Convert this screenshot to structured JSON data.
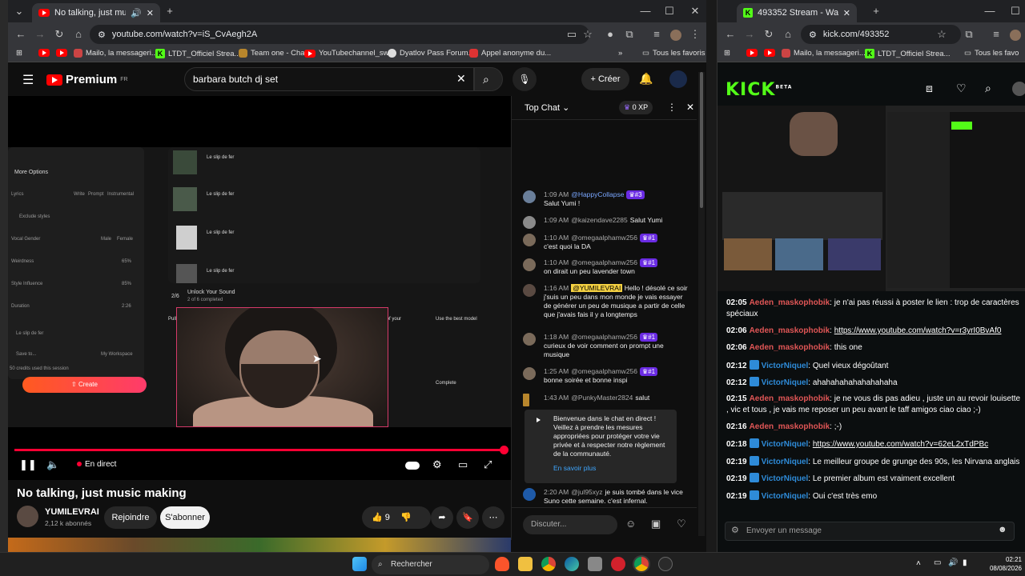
{
  "left_window": {
    "tab_title": "No talking, just music making",
    "url": "youtube.com/watch?v=iS_CvAegh2A",
    "bookmarks": [
      "Mailo, la messageri...",
      "LTDT_Officiel Strea...",
      "Team one - Chat",
      "YouTubechannel_sw...",
      "Dyatlov Pass Forum...",
      "Appel anonyme du..."
    ],
    "bookmarks_all": "Tous les favoris",
    "youtube": {
      "logo": "Premium",
      "logo_sup": "FR",
      "search_value": "barbara butch dj set",
      "create_label": "Créer",
      "video": {
        "live_label": "En direct",
        "progress": 1.0,
        "screen_text": {
          "more_options": "More Options",
          "lyrics": "Lyrics",
          "write": "Write",
          "prompt": "Prompt",
          "instrumental": "Instrumental",
          "exclude_styles": "Exclude styles",
          "vocal_gender": "Vocal Gender",
          "male": "Male",
          "female": "Female",
          "weirdness": "Weirdness",
          "weirdness_val": "65%",
          "style_influence": "Style Influence",
          "style_val": "85%",
          "duration": "Duration",
          "duration_val": "2:26",
          "song_title": "Le slip de fer",
          "save_to": "Save to...",
          "workspace": "My Workspace",
          "credits": "50 credits used this session",
          "create": "Create",
          "unlock": "Unlock Your Sound",
          "unlock_sub": "2 of 6 completed",
          "pull_it_apart": "Pull it apart",
          "share_songs": "Share 5 of your songs",
          "best_model": "Use the best model",
          "complete": "Complete",
          "step_count": "2/6"
        }
      },
      "title": "No talking, just music making",
      "channel": "YUMILEVRAI",
      "subscribers": "2,12 k abonnés",
      "join_label": "Rejoindre",
      "subscribe_label": "S'abonner",
      "likes": "9"
    },
    "chat": {
      "header": "Top Chat",
      "xp": "0 XP",
      "messages": [
        {
          "time": "1:09 AM",
          "author": "@HappyCollapse",
          "badge": "#3",
          "text": "Salut Yumi !",
          "color": "#6a7f9a"
        },
        {
          "time": "1:09 AM",
          "author": "@kaizendave2285",
          "badge": "",
          "text": "Salut Yumi",
          "color": "#8a8a8a"
        },
        {
          "time": "1:10 AM",
          "author": "@omegaalphamw256",
          "badge": "#1",
          "text": "c'est quoi la DA",
          "color": "#7a6a5a"
        },
        {
          "time": "1:10 AM",
          "author": "@omegaalphamw256",
          "badge": "#1",
          "text": "on dirait un peu lavender town",
          "color": "#7a6a5a"
        },
        {
          "time": "1:16 AM",
          "author": "@YUMILEVRAI",
          "badge": "",
          "text": "Hello ! désolé ce soir j'suis un peu dans mon monde je vais essayer de générer un peu de musique a partir de celle que j'avais fais il y a longtemps",
          "color": "#5a4a42"
        },
        {
          "time": "1:18 AM",
          "author": "@omegaalphamw256",
          "badge": "#1",
          "text": "curieux de voir comment on prompt une musique",
          "color": "#7a6a5a"
        },
        {
          "time": "1:25 AM",
          "author": "@omegaalphamw256",
          "badge": "#1",
          "text": "bonne soirée et bonne inspi",
          "color": "#7a6a5a"
        },
        {
          "time": "1:43 AM",
          "author": "@PunkyMaster2824",
          "badge": "",
          "text": "salut",
          "color": "#b8862c"
        }
      ],
      "system_message": "Bienvenue dans le chat en direct ! Veillez à prendre les mesures appropriées pour protéger votre vie privée et à respecter notre règlement de la communauté.",
      "learn_more": "En savoir plus",
      "last_message": {
        "time": "2:20 AM",
        "author": "@jul95xyz",
        "text": "je suis tombé dans le vice Suno cette semaine. c'est infernal."
      },
      "input_placeholder": "Discuter..."
    }
  },
  "right_window": {
    "tab_title": "493352 Stream - Watch Live on ...",
    "url": "kick.com/493352",
    "bookmarks": [
      "Mailo, la messageri...",
      "LTDT_Officiel Strea..."
    ],
    "bookmarks_all": "Tous les favo",
    "logo": "KICK",
    "logo_sup": "BETA",
    "messages": [
      {
        "time": "02:05",
        "user": "Aeden_maskophobik",
        "type": "u1",
        "text": "je n'ai pas réussi à poster le lien : trop de caractères spéciaux",
        "link": ""
      },
      {
        "time": "02:06",
        "user": "Aeden_maskophobik",
        "type": "u1",
        "text": "",
        "link": "https://www.youtube.com/watch?v=r3yrI0BvAf0"
      },
      {
        "time": "02:06",
        "user": "Aeden_maskophobik",
        "type": "u1",
        "text": "this one",
        "link": ""
      },
      {
        "time": "02:12",
        "user": "VictorNiquel",
        "type": "u2",
        "text": "Quel vieux dégoûtant",
        "link": ""
      },
      {
        "time": "02:12",
        "user": "VictorNiquel",
        "type": "u2",
        "text": "ahahahahahahahahaha",
        "link": ""
      },
      {
        "time": "02:15",
        "user": "Aeden_maskophobik",
        "type": "u1",
        "text": "je ne vous dis pas adieu , juste un au revoir louisette , vic et tous , je vais me reposer un peu avant le taff amigos ciao ciao ;-)",
        "link": ""
      },
      {
        "time": "02:16",
        "user": "Aeden_maskophobik",
        "type": "u1",
        "text": ";-)",
        "link": ""
      },
      {
        "time": "02:18",
        "user": "VictorNiquel",
        "type": "u2",
        "text": "",
        "link": "https://www.youtube.com/watch?v=62eL2xTdPBc"
      },
      {
        "time": "02:19",
        "user": "VictorNiquel",
        "type": "u2",
        "text": "Le meilleur groupe de grunge des 90s, les Nirvana anglais",
        "link": ""
      },
      {
        "time": "02:19",
        "user": "VictorNiquel",
        "type": "u2",
        "text": "Le premier album est vraiment excellent",
        "link": ""
      },
      {
        "time": "02:19",
        "user": "VictorNiquel",
        "type": "u2",
        "text": "Oui c'est très emo",
        "link": ""
      }
    ],
    "input_placeholder": "Envoyer un message"
  },
  "taskbar": {
    "search_label": "Rechercher",
    "time": "02:21",
    "date": "08/08/2026"
  },
  "colors": {
    "yt_red": "#ff0033",
    "kick_green": "#53fc18",
    "purple": "#6a2be3"
  }
}
